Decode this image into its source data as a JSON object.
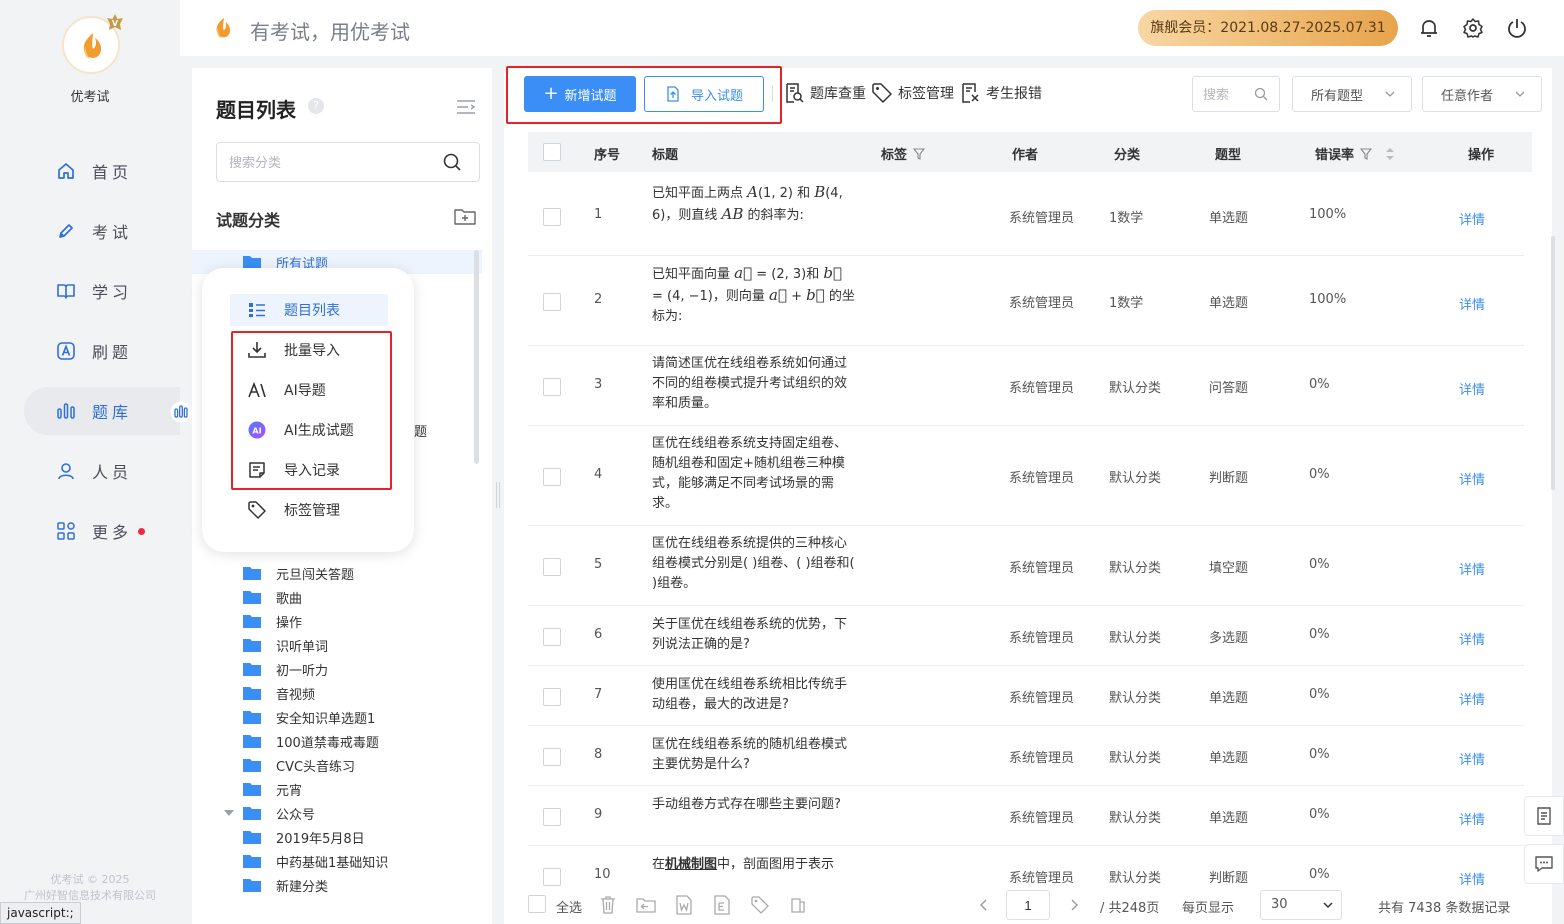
{
  "app": {
    "brand_name": "优考试",
    "slogan": "有考试，用优考试",
    "membership": "旗舰会员：2021.08.27-2025.07.31",
    "copyright_line1": "优考试 © 2025",
    "copyright_line2": "广州好智信息技术有限公司",
    "status_bar": "javascript:;"
  },
  "nav": {
    "items": [
      {
        "label": "首页",
        "icon": "home-icon"
      },
      {
        "label": "考试",
        "icon": "pen-icon"
      },
      {
        "label": "学习",
        "icon": "book-icon"
      },
      {
        "label": "刷题",
        "icon": "a-box-icon"
      },
      {
        "label": "题库",
        "icon": "bar-chart-icon"
      },
      {
        "label": "人员",
        "icon": "user-icon"
      },
      {
        "label": "更多",
        "icon": "grid-icon"
      }
    ],
    "active": "题库"
  },
  "panel": {
    "title": "题目列表",
    "search_placeholder": "搜索分类",
    "section_title": "试题分类",
    "tree": [
      {
        "label": "所有试题",
        "selected": true
      },
      {
        "label": "题"
      },
      {
        "label": "元旦闯关答题"
      },
      {
        "label": "歌曲"
      },
      {
        "label": "操作"
      },
      {
        "label": "识听单词"
      },
      {
        "label": "初一听力"
      },
      {
        "label": "音视频"
      },
      {
        "label": "安全知识单选题1"
      },
      {
        "label": "100道禁毒戒毒题"
      },
      {
        "label": "CVC头音练习"
      },
      {
        "label": "元宵"
      },
      {
        "label": "公众号"
      },
      {
        "label": "2019年5月8日"
      },
      {
        "label": "中药基础1基础知识"
      },
      {
        "label": "新建分类"
      }
    ]
  },
  "popup_menu": {
    "items": [
      {
        "label": "题目列表",
        "icon": "list-icon",
        "active": true
      },
      {
        "label": "批量导入",
        "icon": "download-icon"
      },
      {
        "label": "AI导题",
        "icon": "ai-text-icon"
      },
      {
        "label": "AI生成试题",
        "icon": "ai-badge-icon"
      },
      {
        "label": "导入记录",
        "icon": "note-icon"
      },
      {
        "label": "标签管理",
        "icon": "tag-icon"
      }
    ]
  },
  "toolbar": {
    "add_label": "新增试题",
    "import_label": "导入试题",
    "dedupe_label": "题库查重",
    "tags_label": "标签管理",
    "report_label": "考生报错",
    "search_placeholder": "搜索",
    "type_select": "所有题型",
    "author_select": "任意作者"
  },
  "table": {
    "headers": {
      "index": "序号",
      "title": "标题",
      "tags": "标签",
      "author": "作者",
      "category": "分类",
      "type": "题型",
      "error_rate": "错误率",
      "action": "操作"
    },
    "rows": [
      {
        "index": "1",
        "title_html": "已知平面上两点 <span class='math'>A</span>(1, 2) 和 <span class='math'>B</span>(4, 6)，则直线 <span class='math'>AB</span> 的斜率为:",
        "author": "系统管理员",
        "category": "1数学",
        "type": "单选题",
        "error_rate": "100%",
        "action": "详情"
      },
      {
        "index": "2",
        "title_html": "已知平面向量 <span class='math'>a⃗</span> = (2, 3)和 <span class='math'>b⃗</span> = (4, −1)，则向量 <span class='math'>a⃗</span> + <span class='math'>b⃗</span> 的坐标为:",
        "author": "系统管理员",
        "category": "1数学",
        "type": "单选题",
        "error_rate": "100%",
        "action": "详情"
      },
      {
        "index": "3",
        "title_html": "请简述匡优在线组卷系统如何通过不同的组卷模式提升考试组织的效率和质量。",
        "author": "系统管理员",
        "category": "默认分类",
        "type": "问答题",
        "error_rate": "0%",
        "action": "详情"
      },
      {
        "index": "4",
        "title_html": "匡优在线组卷系统支持固定组卷、随机组卷和固定+随机组卷三种模式，能够满足不同考试场景的需求。",
        "author": "系统管理员",
        "category": "默认分类",
        "type": "判断题",
        "error_rate": "0%",
        "action": "详情"
      },
      {
        "index": "5",
        "title_html": "匡优在线组卷系统提供的三种核心组卷模式分别是(  )组卷、(  )组卷和(  )组卷。",
        "author": "系统管理员",
        "category": "默认分类",
        "type": "填空题",
        "error_rate": "0%",
        "action": "详情"
      },
      {
        "index": "6",
        "title_html": "关于匡优在线组卷系统的优势，下列说法正确的是?",
        "author": "系统管理员",
        "category": "默认分类",
        "type": "多选题",
        "error_rate": "0%",
        "action": "详情"
      },
      {
        "index": "7",
        "title_html": "使用匡优在线组卷系统相比传统手动组卷，最大的改进是?",
        "author": "系统管理员",
        "category": "默认分类",
        "type": "单选题",
        "error_rate": "0%",
        "action": "详情"
      },
      {
        "index": "8",
        "title_html": "匡优在线组卷系统的随机组卷模式主要优势是什么?",
        "author": "系统管理员",
        "category": "默认分类",
        "type": "单选题",
        "error_rate": "0%",
        "action": "详情"
      },
      {
        "index": "9",
        "title_html": "手动组卷方式存在哪些主要问题?",
        "author": "系统管理员",
        "category": "默认分类",
        "type": "单选题",
        "error_rate": "0%",
        "action": "详情"
      },
      {
        "index": "10",
        "title_html": "在<span class='bold-u'>机械制图</span>中，剖面图用于表示",
        "author": "系统管理员",
        "category": "默认分类",
        "type": "判断题",
        "error_rate": "0%",
        "action": "详情"
      }
    ]
  },
  "footer": {
    "select_all": "全选",
    "page": "1",
    "total_pages": "/ 共248页",
    "per_page_label": "每页显示",
    "per_page": "30",
    "total_records": "共有 7438 条数据记录"
  },
  "colors": {
    "primary": "#3a8ef6",
    "nav_active": "#2f6fd9",
    "highlight_box": "#e8222b",
    "vip_gradient_start": "#f8d7a4",
    "vip_gradient_end": "#e7a44b"
  }
}
